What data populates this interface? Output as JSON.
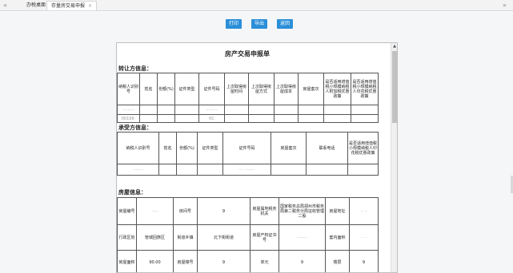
{
  "tabbar": {
    "nav_prev": "«",
    "nav_next": "»",
    "tabs": [
      {
        "label": "办税桌面"
      },
      {
        "label": "存量房交易申报",
        "close": "×"
      }
    ]
  },
  "toolbar": {
    "print_label": "打印",
    "export_label": "导出",
    "back_label": "返回"
  },
  "form": {
    "title": "房产交易申报单",
    "seller_section": "转让方信息：",
    "seller_headers": [
      "纳税人识别号",
      "姓名",
      "份额(%)",
      "证件类型",
      "证件号码",
      "上次取得房屋时间",
      "上次取得房屋方式",
      "上次取得房屋成本",
      "房屋套次",
      "是否适用增值税小规模纳税人附加税优惠政策",
      "是否适用增值税小规模纳税人印花税优惠政策"
    ],
    "seller_row1": [
      "·········",
      "",
      "",
      "",
      "·········",
      "",
      "",
      "",
      "",
      "",
      ""
    ],
    "seller_row2": [
      "00196·",
      "",
      "",
      "",
      "0C",
      "",
      "",
      "",
      "",
      "",
      ""
    ],
    "buyer_section": "承受方信息：",
    "buyer_headers": [
      "纳税人识别号",
      "姓名",
      "份额(%)",
      "证件类型",
      "证件号码",
      "房屋套次",
      "联系电话",
      "是否适用增值税小规模纳税人印花税优惠政策"
    ],
    "buyer_row1": [
      "········",
      "",
      "",
      "",
      "··· ········",
      "",
      "",
      ""
    ],
    "house_section": "房屋信息：",
    "house": {
      "r1": [
        "房屋编号",
        "·····",
        "房间号",
        "9",
        "房屋属地税务机关",
        "国家税务总局郑州市税务局第二税务分局征收管理二股",
        "房屋地址",
        "·· ··"
      ],
      "r2": [
        "行政区划",
        "管城回族区",
        "街道乡镇",
        "北下街街道",
        "房屋产权证书号",
        "········",
        "套内面积",
        "· · ·"
      ],
      "r3": [
        "房屋面积",
        "90.00",
        "房屋幢号",
        "9",
        "单元",
        "9",
        "楼层",
        "9"
      ]
    }
  }
}
